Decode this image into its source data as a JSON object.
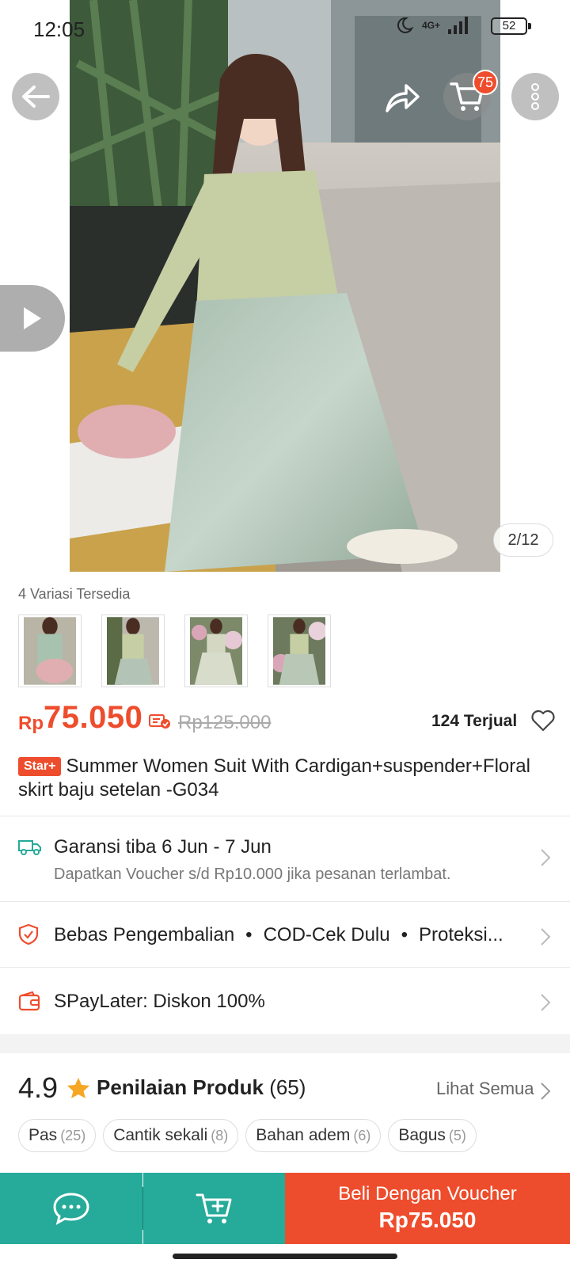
{
  "status_bar": {
    "time": "12:05",
    "network": "4G+",
    "battery": "52"
  },
  "gallery": {
    "counter": "2/12",
    "cart_count": "75"
  },
  "variants": {
    "label": "4 Variasi Tersedia"
  },
  "price": {
    "currency": "Rp",
    "current": "75.050",
    "original": "Rp125.000",
    "sold": "124 Terjual"
  },
  "product": {
    "badge": "Star+",
    "title": "Summer Women Suit With Cardigan+suspender+Floral skirt  baju   setelan -G034"
  },
  "shipping": {
    "title": "Garansi tiba 6 Jun - 7 Jun",
    "subtitle": "Dapatkan Voucher s/d Rp10.000 jika pesanan terlambat."
  },
  "services": {
    "items": [
      "Bebas Pengembalian",
      "COD-Cek Dulu",
      "Proteksi..."
    ]
  },
  "paylater": {
    "text": "SPayLater: Diskon 100%"
  },
  "ratings": {
    "score": "4.9",
    "title": "Penilaian Produk",
    "count": "(65)",
    "see_all": "Lihat Semua",
    "chips": [
      {
        "label": "Pas",
        "count": "(25)"
      },
      {
        "label": "Cantik sekali",
        "count": "(8)"
      },
      {
        "label": "Bahan adem",
        "count": "(6)"
      },
      {
        "label": "Bagus",
        "count": "(5)"
      }
    ]
  },
  "bottom_bar": {
    "buy_label": "Beli Dengan Voucher",
    "buy_price": "Rp75.050"
  },
  "colors": {
    "primary": "#ee4d2d",
    "teal": "#26aa99"
  }
}
